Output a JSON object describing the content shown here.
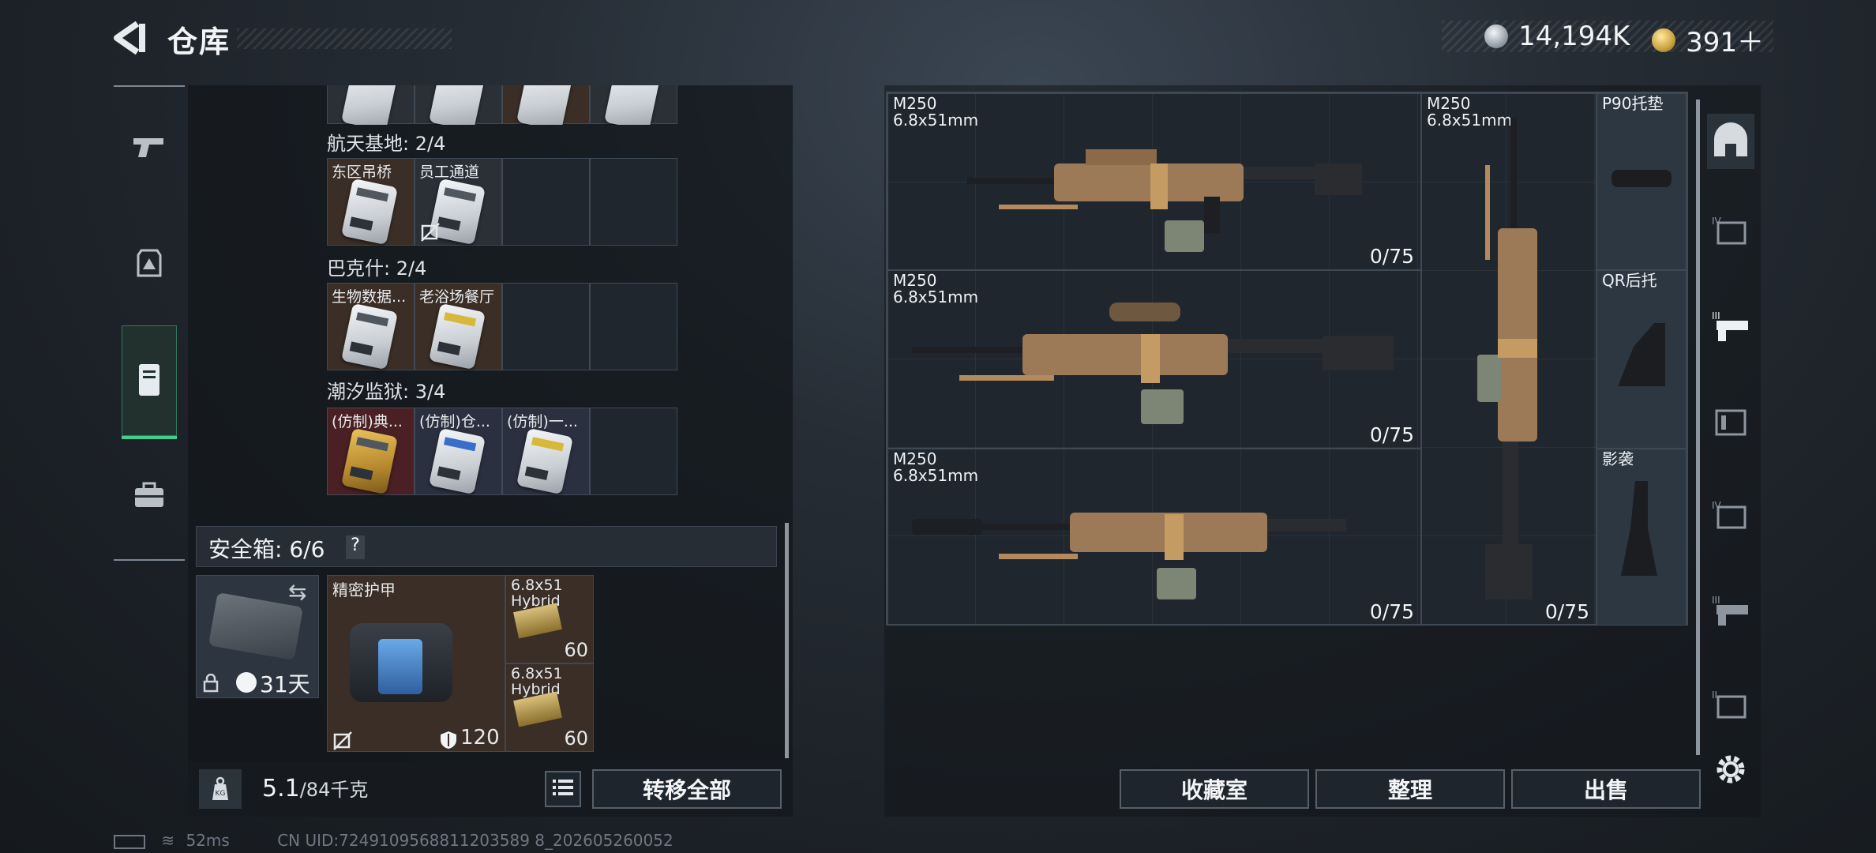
{
  "header": {
    "title": "仓库",
    "currency": [
      {
        "icon": "silver-coin-icon",
        "value": "14,194K"
      },
      {
        "icon": "gold-coin-icon",
        "value": "391＋"
      }
    ]
  },
  "left_tabs": [
    {
      "name": "weapons",
      "icon": "pistol-icon"
    },
    {
      "name": "equipment",
      "icon": "armor-badge-icon"
    },
    {
      "name": "warehouse",
      "icon": "locker-icon",
      "selected": true
    },
    {
      "name": "toolbox",
      "icon": "briefcase-icon"
    }
  ],
  "keycards": {
    "sections": [
      {
        "label": "航天基地: 2/4",
        "items": [
          {
            "name": "东区吊桥",
            "style": "white",
            "bg": "#3a2e26",
            "locked": false
          },
          {
            "name": "员工通道",
            "style": "white",
            "bg": "#2b2f36",
            "locked": true
          }
        ]
      },
      {
        "label": "巴克什: 2/4",
        "items": [
          {
            "name": "生物数据...",
            "style": "white",
            "bg": "#3a2e26",
            "locked": false
          },
          {
            "name": "老浴场餐厅",
            "style": "yel",
            "bg": "#3a2e26",
            "locked": false
          }
        ]
      },
      {
        "label": "潮汐监狱: 3/4",
        "items": [
          {
            "name": "(仿制)典...",
            "style": "gold",
            "bg": "#4a2024",
            "locked": false
          },
          {
            "name": "(仿制)仓...",
            "style": "blue",
            "bg": "#2b3040",
            "locked": false
          },
          {
            "name": "(仿制)一...",
            "style": "yel",
            "bg": "#2b3040",
            "locked": false
          }
        ]
      }
    ]
  },
  "safe_box": {
    "label": "安全箱: 6/6",
    "help": "?",
    "case_days": "31天",
    "armor_name": "精密护甲",
    "armor_durability": "120",
    "ammo": [
      {
        "name": "6.8x51 Hybrid",
        "count": "60"
      },
      {
        "name": "6.8x51 Hybrid",
        "count": "60"
      }
    ]
  },
  "footer_left": {
    "weight_current": "5.1",
    "weight_max": "/84千克",
    "weight_icon": "KG",
    "transfer_all": "转移全部"
  },
  "weapons": [
    {
      "name": "M250",
      "caliber": "6.8x51mm",
      "ammo": "0/75"
    },
    {
      "name": "M250",
      "caliber": "6.8x51mm",
      "ammo": "0/75"
    },
    {
      "name": "M250",
      "caliber": "6.8x51mm",
      "ammo": "0/75"
    },
    {
      "name": "M250",
      "caliber": "6.8x51mm",
      "ammo": "0/75"
    }
  ],
  "attachments": [
    {
      "name": "P90托垫"
    },
    {
      "name": "QR后托"
    },
    {
      "name": "影袭"
    }
  ],
  "footer_right": {
    "collection": "收藏室",
    "organize": "整理",
    "sell": "出售"
  },
  "right_tabs": [
    "home-shelter-icon",
    "tier4-armor-icon",
    "tier3-rifle-icon",
    "ammo-box-icon",
    "tier4-armor-icon",
    "tier3-rifle-icon",
    "tier2-armor-icon"
  ],
  "status": {
    "ping": "52ms",
    "uid": "CN UID:7249109568811203589 8_202605260052"
  }
}
